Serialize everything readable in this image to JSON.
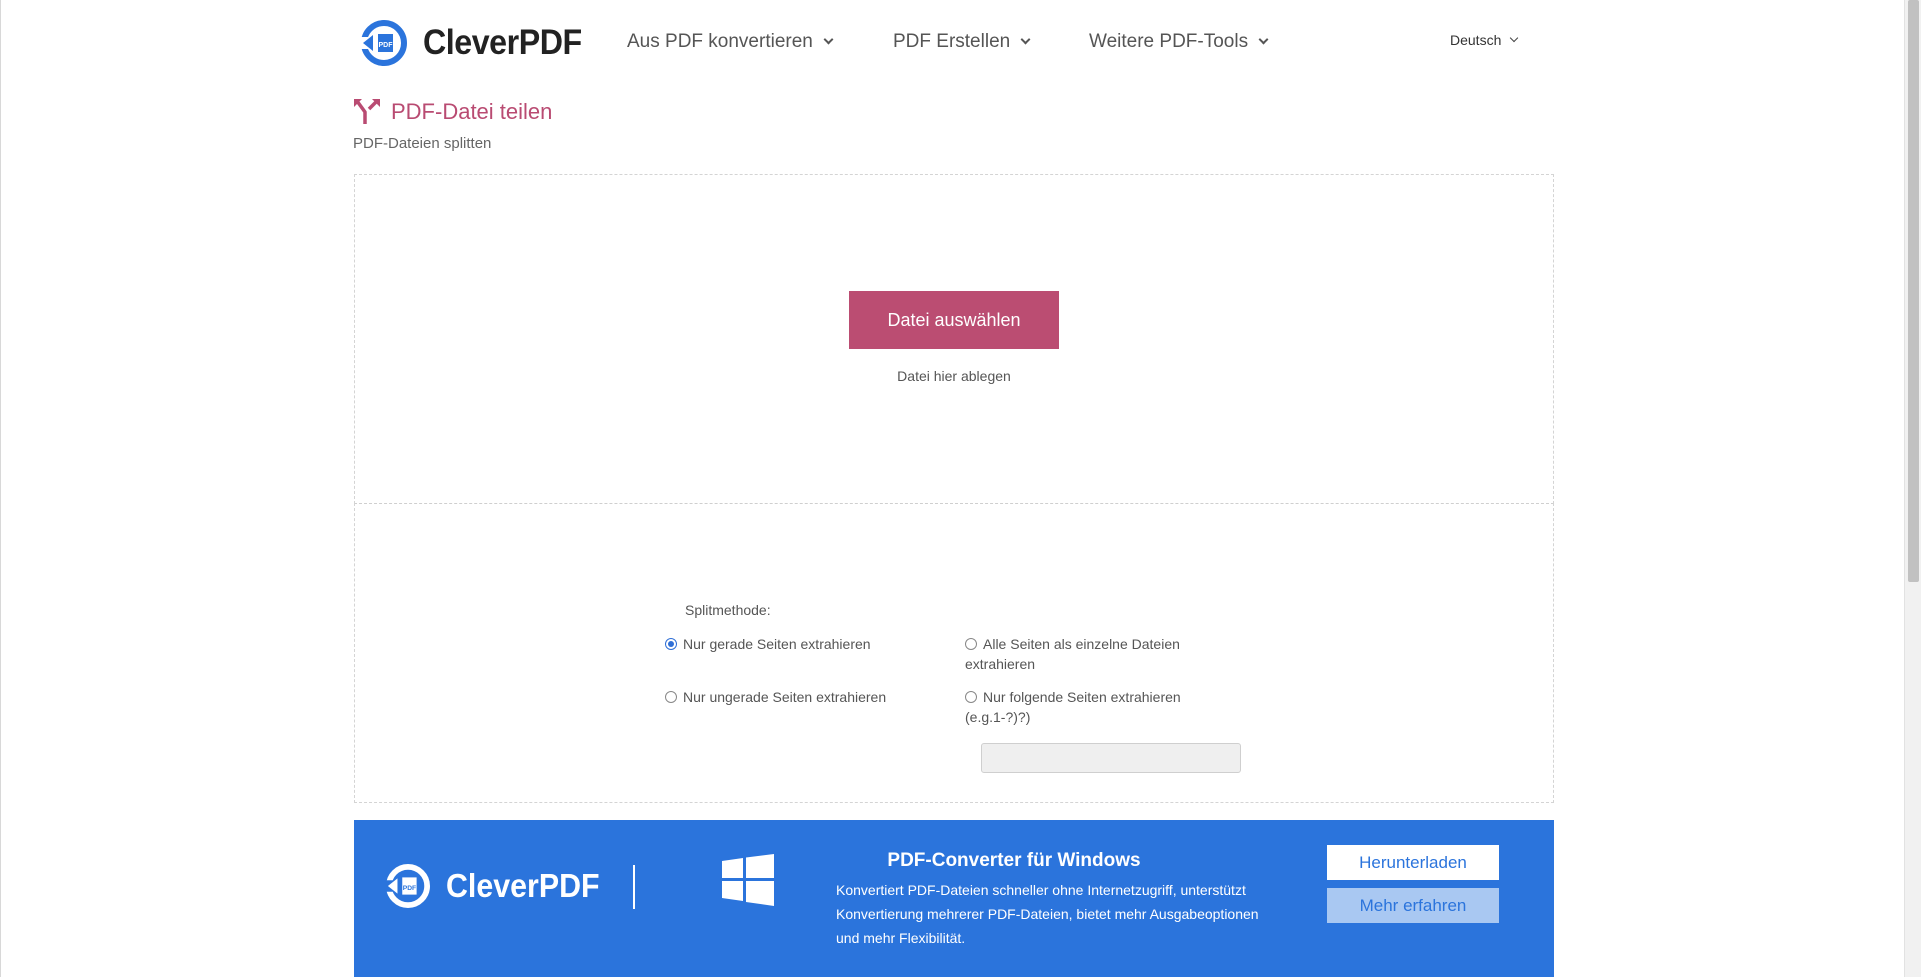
{
  "header": {
    "logo_text": "CleverPDF",
    "nav": [
      {
        "label": "Aus PDF konvertieren"
      },
      {
        "label": "PDF Erstellen"
      },
      {
        "label": "Weitere PDF-Tools"
      }
    ],
    "language": "Deutsch"
  },
  "page": {
    "title": "PDF-Datei teilen",
    "subtitle": "PDF-Dateien splitten"
  },
  "upload": {
    "choose_button": "Datei auswählen",
    "drop_hint": "Datei hier ablegen"
  },
  "options": {
    "split_label": "Splitmethode:",
    "radios": [
      {
        "label": "Nur gerade Seiten extrahieren",
        "checked": true
      },
      {
        "label": "Nur ungerade Seiten extrahieren",
        "checked": false
      },
      {
        "label": "Alle Seiten als einzelne Dateien extrahieren",
        "checked": false
      },
      {
        "label": "Nur folgende Seiten extrahieren (e.g.1-?)?)",
        "checked": false
      }
    ],
    "range_value": ""
  },
  "promo": {
    "logo_text": "CleverPDF",
    "title": "PDF-Converter für Windows",
    "description": "Konvertiert PDF-Dateien schneller ohne Internetzugriff, unterstützt Konvertierung mehrerer PDF-Dateien, bietet mehr Ausgabeoptionen und mehr Flexibilität.",
    "download_button": "Herunterladen",
    "more_button": "Mehr erfahren"
  },
  "colors": {
    "accent": "#bb4d72",
    "promo_bg": "#2b74dc",
    "logo_blue": "#2b74dc"
  }
}
